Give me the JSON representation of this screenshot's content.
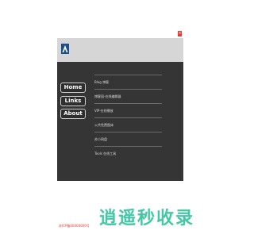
{
  "window": {
    "close_label": "×"
  },
  "nav": {
    "items": [
      {
        "label": "Home"
      },
      {
        "label": "Links"
      },
      {
        "label": "About"
      }
    ]
  },
  "links": [
    {
      "label": "Blog 博客"
    },
    {
      "label": "博客园-在线编辑器"
    },
    {
      "label": "VIP-在线播放"
    },
    {
      "label": "公共免费图床"
    },
    {
      "label": "苏小网盘"
    },
    {
      "label": "Tools 在线工具"
    }
  ],
  "footer": {
    "icp": "苏ICP备00000000号"
  },
  "watermark": {
    "text": "逍遥秒收录"
  },
  "colors": {
    "panel": "#353535",
    "header": "#d6d6d6",
    "accent_red": "#e53935",
    "watermark": "#43c7a6",
    "logo": "#1e4e8c"
  }
}
